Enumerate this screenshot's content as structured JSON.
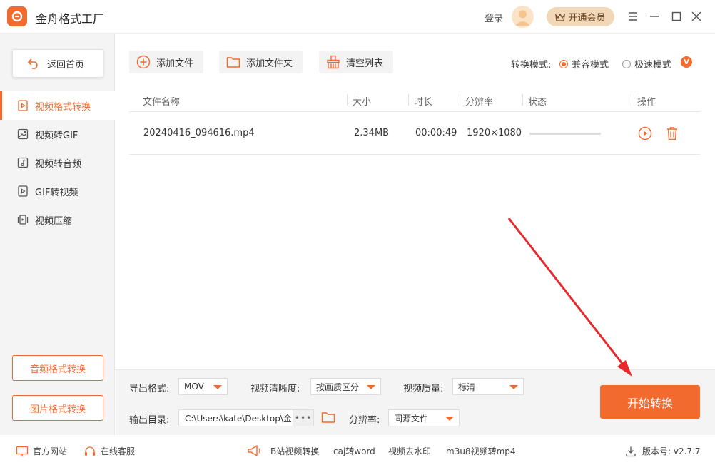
{
  "app": {
    "title": "金舟格式工厂"
  },
  "header": {
    "login_label": "登录",
    "vip_label": "开通会员"
  },
  "sidebar": {
    "back_label": "返回首页",
    "items": [
      {
        "label": "视频格式转换",
        "icon": "video-file-icon",
        "active": true
      },
      {
        "label": "视频转GIF",
        "icon": "image-icon"
      },
      {
        "label": "视频转音频",
        "icon": "audio-file-icon"
      },
      {
        "label": "GIF转视频",
        "icon": "play-file-icon"
      },
      {
        "label": "视频压缩",
        "icon": "compress-icon"
      }
    ],
    "audio_convert_label": "音频格式转换",
    "image_convert_label": "图片格式转换"
  },
  "toolbar": {
    "add_file_label": "添加文件",
    "add_folder_label": "添加文件夹",
    "clear_list_label": "清空列表",
    "mode_label": "转换模式:",
    "mode_options": [
      "兼容模式",
      "极速模式"
    ],
    "mode_selected": "兼容模式",
    "vip_badge": "V"
  },
  "table": {
    "headers": [
      "文件名称",
      "大小",
      "时长",
      "分辨率",
      "状态",
      "操作"
    ],
    "rows": [
      {
        "name": "20240416_094616.mp4",
        "size": "2.34MB",
        "duration": "00:00:49",
        "resolution": "1920×1080",
        "progress": 0
      }
    ]
  },
  "settings": {
    "export_format_label": "导出格式:",
    "export_format_value": "MOV",
    "clarity_label": "视频清晰度:",
    "clarity_value": "按画质区分",
    "quality_label": "视频质量:",
    "quality_value": "标清",
    "output_dir_label": "输出目录:",
    "output_dir_value": "C:\\Users\\kate\\Desktop\\金",
    "output_dir_more": "•••",
    "resolution_label": "分辨率:",
    "resolution_value": "同源文件",
    "start_label": "开始转换"
  },
  "footer": {
    "website_label": "官方网站",
    "service_label": "在线客服",
    "links": [
      "B站视频转换",
      "caj转word",
      "视频去水印",
      "m3u8视频转mp4"
    ],
    "version_label": "版本号: v2.7.7"
  },
  "colors": {
    "accent": "#f26a2e",
    "arrow": "#e8292b"
  }
}
